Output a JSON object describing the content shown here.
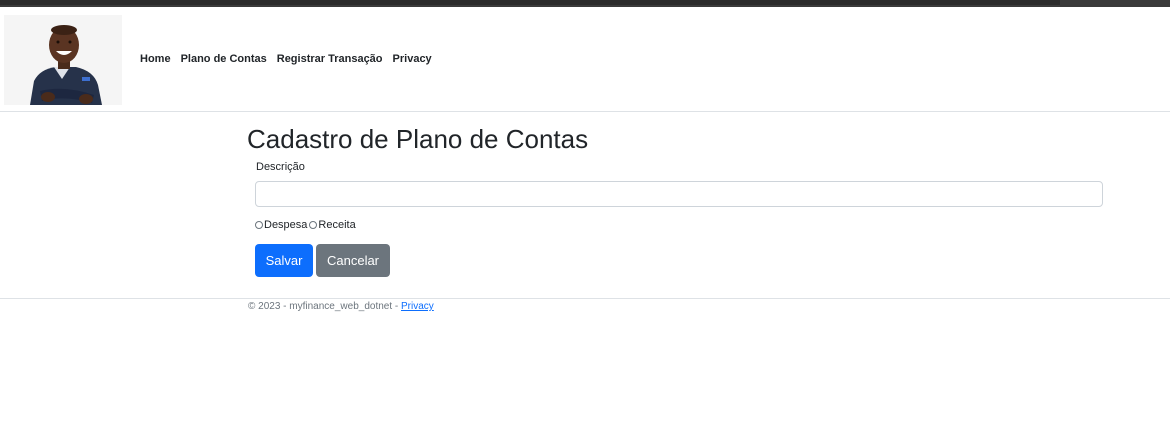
{
  "nav": {
    "items": [
      "Home",
      "Plano de Contas",
      "Registrar Transação",
      "Privacy"
    ]
  },
  "page": {
    "title": "Cadastro de Plano de Contas"
  },
  "form": {
    "descricao_label": "Descrição",
    "descricao_value": "",
    "radio_despesa": "Despesa",
    "radio_receita": "Receita",
    "save_label": "Salvar",
    "cancel_label": "Cancelar"
  },
  "footer": {
    "text": "© 2023 - myfinance_web_dotnet -",
    "privacy_link": "Privacy"
  },
  "colors": {
    "primary": "#0d6efd",
    "secondary": "#6c757d"
  }
}
